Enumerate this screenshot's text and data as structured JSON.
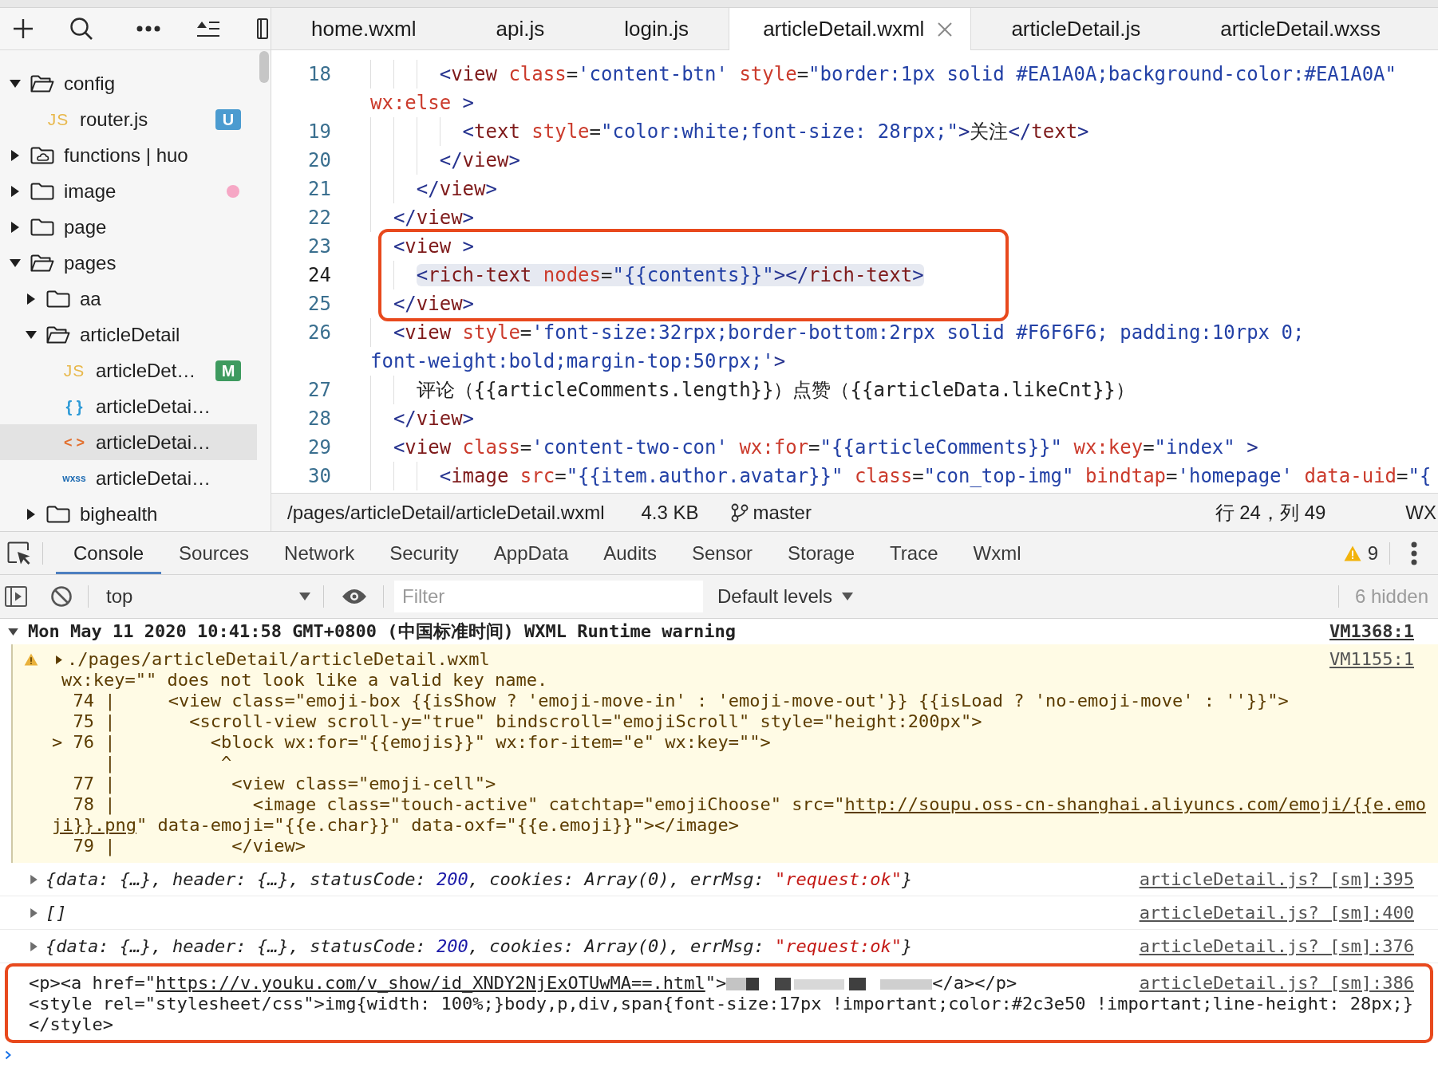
{
  "sidebar": {
    "tree": [
      {
        "kind": "folder",
        "label": "config",
        "expanded": true,
        "selected": false,
        "children": [
          {
            "kind": "js",
            "icon": "JS",
            "label": "router.js",
            "selected": false,
            "badge": {
              "text": "U",
              "color": "#4b9bd0"
            }
          }
        ]
      },
      {
        "kind": "cloud-folder",
        "label": "functions | huo",
        "expanded": false,
        "selected": false
      },
      {
        "kind": "folder",
        "label": "image",
        "expanded": false,
        "selected": false,
        "dot": {
          "color": "#f6a7c5"
        }
      },
      {
        "kind": "folder",
        "label": "page",
        "expanded": false,
        "selected": false
      },
      {
        "kind": "folder",
        "label": "pages",
        "expanded": true,
        "selected": false,
        "children": [
          {
            "kind": "folder",
            "label": "aa",
            "expanded": false,
            "selected": false
          },
          {
            "kind": "folder",
            "label": "articleDetail",
            "expanded": true,
            "selected": false,
            "children": [
              {
                "kind": "js",
                "icon": "JS",
                "label": "articleDet…",
                "selected": false,
                "badge": {
                  "text": "M",
                  "color": "#3e9a5f"
                }
              },
              {
                "kind": "json",
                "icon": "{ }",
                "label": "articleDetai…",
                "selected": false
              },
              {
                "kind": "wxml",
                "icon": "< >",
                "label": "articleDetai…",
                "selected": true
              },
              {
                "kind": "wxss",
                "icon": "wxss",
                "label": "articleDetai…",
                "selected": false
              }
            ]
          },
          {
            "kind": "folder",
            "label": "bighealth",
            "expanded": false,
            "selected": false
          }
        ]
      }
    ]
  },
  "tabs": [
    {
      "label": "home.wxml",
      "selected": false
    },
    {
      "label": "api.js",
      "selected": false
    },
    {
      "label": "login.js",
      "selected": false
    },
    {
      "label": "articleDetail.wxml",
      "selected": true
    },
    {
      "label": "articleDetail.js",
      "selected": false
    },
    {
      "label": "articleDetail.wxss",
      "selected": false
    }
  ],
  "editor": {
    "blocks": [
      {
        "boxed": false,
        "lines": [
          {
            "number": "18",
            "current": false,
            "segments": [
              {
                "kind": "bracket",
                "text": "      <"
              },
              {
                "kind": "tag",
                "text": "view"
              },
              {
                "kind": "attr",
                "text": " class"
              },
              {
                "kind": "eq",
                "text": "="
              },
              {
                "kind": "string",
                "text": "'content-btn'"
              },
              {
                "kind": "attr",
                "text": " style"
              },
              {
                "kind": "eq",
                "text": "="
              },
              {
                "kind": "string",
                "text": "\"border:1px solid #EA1A0A;background-color:#EA1A0A\""
              }
            ],
            "wrap": {
              "segments": [
                {
                  "kind": "attr",
                  "text": "wx:else"
                },
                {
                  "kind": "bracket",
                  "text": " >"
                }
              ]
            }
          },
          {
            "number": "19",
            "current": false,
            "segments": [
              {
                "kind": "bracket",
                "text": "        <"
              },
              {
                "kind": "tag",
                "text": "text"
              },
              {
                "kind": "attr",
                "text": " style"
              },
              {
                "kind": "eq",
                "text": "="
              },
              {
                "kind": "string",
                "text": "\"color:white;font-size: 28rpx;\""
              },
              {
                "kind": "bracket",
                "text": ">"
              },
              {
                "kind": "text",
                "text": "关注"
              },
              {
                "kind": "bracket",
                "text": "</"
              },
              {
                "kind": "tag",
                "text": "text"
              },
              {
                "kind": "bracket",
                "text": ">"
              }
            ]
          },
          {
            "number": "20",
            "current": false,
            "segments": [
              {
                "kind": "bracket",
                "text": "      </"
              },
              {
                "kind": "tag",
                "text": "view"
              },
              {
                "kind": "bracket",
                "text": ">"
              }
            ]
          },
          {
            "number": "21",
            "current": false,
            "segments": [
              {
                "kind": "bracket",
                "text": "    </"
              },
              {
                "kind": "tag",
                "text": "view"
              },
              {
                "kind": "bracket",
                "text": ">"
              }
            ]
          },
          {
            "number": "22",
            "current": false,
            "segments": [
              {
                "kind": "bracket",
                "text": "  </"
              },
              {
                "kind": "tag",
                "text": "view"
              },
              {
                "kind": "bracket",
                "text": ">"
              }
            ]
          }
        ]
      },
      {
        "boxed": true,
        "lines": [
          {
            "number": "23",
            "current": false,
            "segments": [
              {
                "kind": "bracket",
                "text": "  <"
              },
              {
                "kind": "tag",
                "text": "view"
              },
              {
                "kind": "bracket",
                "text": " >"
              }
            ]
          },
          {
            "number": "24",
            "current": true,
            "segments": [
              {
                "kind": "bracket",
                "text": "    <"
              },
              {
                "kind": "tag",
                "text": "rich-text"
              },
              {
                "kind": "attr",
                "text": " nodes"
              },
              {
                "kind": "eq",
                "text": "="
              },
              {
                "kind": "string",
                "text": "\"{{contents}}\""
              },
              {
                "kind": "bracket",
                "text": "></"
              },
              {
                "kind": "tag",
                "text": "rich-text"
              },
              {
                "kind": "bracket",
                "text": ">"
              }
            ]
          },
          {
            "number": "25",
            "current": false,
            "segments": [
              {
                "kind": "bracket",
                "text": "  </"
              },
              {
                "kind": "tag",
                "text": "view"
              },
              {
                "kind": "bracket",
                "text": ">"
              }
            ]
          }
        ]
      },
      {
        "boxed": false,
        "lines": [
          {
            "number": "26",
            "current": false,
            "segments": [
              {
                "kind": "bracket",
                "text": "  <"
              },
              {
                "kind": "tag",
                "text": "view"
              },
              {
                "kind": "attr",
                "text": " style"
              },
              {
                "kind": "eq",
                "text": "="
              },
              {
                "kind": "string",
                "text": "'font-size:32rpx;border-bottom:2rpx solid #F6F6F6; padding:10rpx 0;"
              }
            ],
            "wrap": {
              "segments": [
                {
                  "kind": "string",
                  "text": "font-weight:bold;margin-top:50rpx;'"
                },
                {
                  "kind": "bracket",
                  "text": ">"
                }
              ]
            }
          },
          {
            "number": "27",
            "current": false,
            "segments": [
              {
                "kind": "text",
                "text": "    评论（{{articleComments.length}}）点赞（{{articleData.likeCnt}}）"
              }
            ]
          },
          {
            "number": "28",
            "current": false,
            "segments": [
              {
                "kind": "bracket",
                "text": "  </"
              },
              {
                "kind": "tag",
                "text": "view"
              },
              {
                "kind": "bracket",
                "text": ">"
              }
            ]
          },
          {
            "number": "29",
            "current": false,
            "segments": [
              {
                "kind": "bracket",
                "text": "  <"
              },
              {
                "kind": "tag",
                "text": "view"
              },
              {
                "kind": "attr",
                "text": " class"
              },
              {
                "kind": "eq",
                "text": "="
              },
              {
                "kind": "string",
                "text": "'content-two-con'"
              },
              {
                "kind": "attr",
                "text": " wx:for"
              },
              {
                "kind": "eq",
                "text": "="
              },
              {
                "kind": "string",
                "text": "\"{{articleComments}}\""
              },
              {
                "kind": "attr",
                "text": " wx:key"
              },
              {
                "kind": "eq",
                "text": "="
              },
              {
                "kind": "string",
                "text": "\"index\""
              },
              {
                "kind": "bracket",
                "text": " >"
              }
            ]
          },
          {
            "number": "30",
            "current": false,
            "segments": [
              {
                "kind": "bracket",
                "text": "      <"
              },
              {
                "kind": "tag",
                "text": "image"
              },
              {
                "kind": "attr",
                "text": " src"
              },
              {
                "kind": "eq",
                "text": "="
              },
              {
                "kind": "string",
                "text": "\"{{item.author.avatar}}\""
              },
              {
                "kind": "attr",
                "text": " class"
              },
              {
                "kind": "eq",
                "text": "="
              },
              {
                "kind": "string",
                "text": "\"con_top-img\""
              },
              {
                "kind": "attr",
                "text": " bindtap"
              },
              {
                "kind": "eq",
                "text": "="
              },
              {
                "kind": "string",
                "text": "'homepage'"
              },
              {
                "kind": "attr",
                "text": " data-uid"
              },
              {
                "kind": "eq",
                "text": "="
              },
              {
                "kind": "string",
                "text": "\"{"
              }
            ]
          }
        ]
      }
    ]
  },
  "status_bar": {
    "path": "/pages/articleDetail/articleDetail.wxml",
    "size": "4.3 KB",
    "branch": "master",
    "cursor": "行 24，列 49",
    "language": "WX"
  },
  "devtools": {
    "tabs": [
      {
        "label": "Console",
        "selected": true
      },
      {
        "label": "Sources",
        "selected": false
      },
      {
        "label": "Network",
        "selected": false
      },
      {
        "label": "Security",
        "selected": false
      },
      {
        "label": "AppData",
        "selected": false
      },
      {
        "label": "Audits",
        "selected": false
      },
      {
        "label": "Sensor",
        "selected": false
      },
      {
        "label": "Storage",
        "selected": false
      },
      {
        "label": "Trace",
        "selected": false
      },
      {
        "label": "Wxml",
        "selected": false
      }
    ],
    "warning_count": "9",
    "toolbar": {
      "context": "top",
      "filter": {
        "placeholder": "Filter"
      },
      "levels": "Default levels",
      "hidden": "6 hidden"
    },
    "console": [
      {
        "kind": "group",
        "expanded": true,
        "boxed": false,
        "title": "Mon May 11 2020 10:41:58 GMT+0800 (中国标准时间) WXML Runtime warning",
        "source": "VM1368:1",
        "children": [
          {
            "kind": "warning",
            "expanded": false,
            "boxed": false,
            "file": "./pages/articleDetail/articleDetail.wxml",
            "source": "VM1155:1",
            "message": "wx:key=\"\" does not look like a valid key name.",
            "code": [
              {
                "segments": [
                  {
                    "kind": "text",
                    "text": "  74 |     <view class=\"emoji-box {{isShow ? 'emoji-move-in' : 'emoji-move-out'}} {{isLoad ? 'no-emoji-move' : ''}}\">"
                  }
                ]
              },
              {
                "segments": [
                  {
                    "kind": "text",
                    "text": "  75 |       <scroll-view scroll-y=\"true\" bindscroll=\"emojiScroll\" style=\"height:200px\">"
                  }
                ]
              },
              {
                "segments": [
                  {
                    "kind": "text",
                    "text": "> 76 |         <block wx:for=\"{{emojis}}\" wx:for-item=\"e\" wx:key=\"\">"
                  }
                ]
              },
              {
                "segments": [
                  {
                    "kind": "text",
                    "text": "     |          ^"
                  }
                ]
              },
              {
                "segments": [
                  {
                    "kind": "text",
                    "text": "  77 |           <view class=\"emoji-cell\">"
                  }
                ]
              },
              {
                "segments": [
                  {
                    "kind": "text",
                    "text": "  78 |             <image class=\"touch-active\" catchtap=\"emojiChoose\" src=\""
                  },
                  {
                    "kind": "link",
                    "text": "http://soupu.oss-cn-shanghai.aliyuncs.com/emoji/{{e.emo"
                  }
                ]
              },
              {
                "segments": [
                  {
                    "kind": "link",
                    "text": "ji}}.png"
                  },
                  {
                    "kind": "text",
                    "text": "\" data-emoji=\"{{e.char}}\" data-oxf=\"{{e.emoji}}\"></image>"
                  }
                ]
              },
              {
                "segments": [
                  {
                    "kind": "text",
                    "text": "  79 |           </view>"
                  }
                ]
              }
            ]
          }
        ]
      },
      {
        "kind": "object",
        "expanded": false,
        "boxed": false,
        "lines": [
          {
            "segments": [
              {
                "kind": "text",
                "text": "{data: {…}, header: {…}, statusCode: "
              },
              {
                "kind": "number",
                "text": "200"
              },
              {
                "kind": "text",
                "text": ", cookies: Array(0), errMsg: "
              },
              {
                "kind": "string",
                "text": "\"request:ok\""
              },
              {
                "kind": "text",
                "text": "}"
              }
            ]
          }
        ],
        "source": "articleDetail.js? [sm]:395"
      },
      {
        "kind": "object",
        "expanded": false,
        "boxed": false,
        "lines": [
          {
            "segments": [
              {
                "kind": "text",
                "text": "[]"
              }
            ]
          }
        ],
        "source": "articleDetail.js? [sm]:400"
      },
      {
        "kind": "object",
        "expanded": false,
        "boxed": false,
        "lines": [
          {
            "segments": [
              {
                "kind": "text",
                "text": "{data: {…}, header: {…}, statusCode: "
              },
              {
                "kind": "number",
                "text": "200"
              },
              {
                "kind": "text",
                "text": ", cookies: Array(0), errMsg: "
              },
              {
                "kind": "string",
                "text": "\"request:ok\""
              },
              {
                "kind": "text",
                "text": "}"
              }
            ]
          }
        ],
        "source": "articleDetail.js? [sm]:376"
      },
      {
        "kind": "string",
        "boxed": true,
        "lines": [
          {
            "segments": [
              {
                "kind": "text",
                "text": "<p><a href=\""
              },
              {
                "kind": "link",
                "text": "https://v.youku.com/v_show/id_XNDY2NjExOTUwMA==.html"
              },
              {
                "kind": "text",
                "text": "\">"
              },
              {
                "kind": "redacted"
              },
              {
                "kind": "text",
                "text": "</a></p>"
              }
            ]
          },
          {
            "segments": [
              {
                "kind": "text",
                "text": "<style rel=\"stylesheet/css\">img{width: 100%;}body,p,div,span{font-size:17px !important;color:#2c3e50 !important;line-height: 28px;}"
              }
            ]
          },
          {
            "segments": [
              {
                "kind": "text",
                "text": "</style>"
              }
            ]
          }
        ],
        "source": "articleDetail.js? [sm]:386"
      }
    ]
  }
}
